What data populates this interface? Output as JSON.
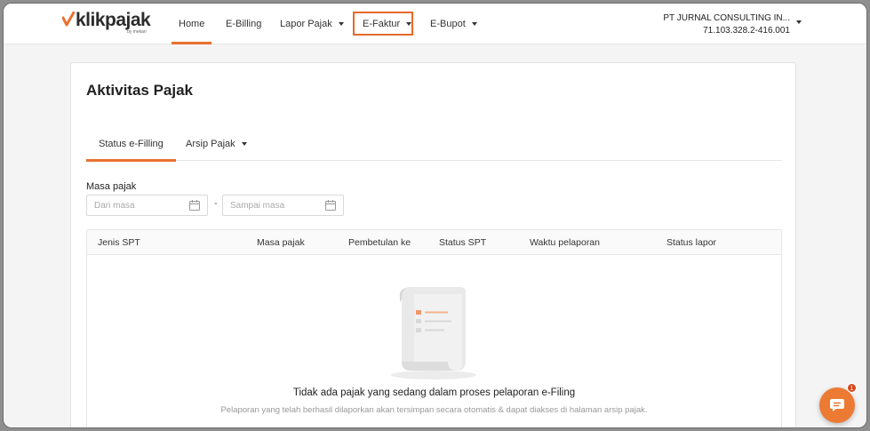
{
  "brand": {
    "name": "klikpajak",
    "sub": "by mekari",
    "accent_color": "#e9702f"
  },
  "nav": {
    "items": [
      {
        "label": "Home",
        "active": true
      },
      {
        "label": "E-Billing"
      },
      {
        "label": "Lapor Pajak",
        "dropdown": true
      },
      {
        "label": "E-Faktur",
        "dropdown": true,
        "highlighted": true
      },
      {
        "label": "E-Bupot",
        "dropdown": true
      }
    ],
    "company": {
      "name": "PT JURNAL CONSULTING IN...",
      "npwp": "71.103.328.2-416.001"
    }
  },
  "page": {
    "title": "Aktivitas Pajak",
    "tabs": [
      {
        "label": "Status e-Filling",
        "active": true
      },
      {
        "label": "Arsip Pajak",
        "dropdown": true
      }
    ],
    "filter": {
      "label": "Masa pajak",
      "from_placeholder": "Dari masa",
      "to_placeholder": "Sampai masa",
      "separator": "-"
    },
    "table": {
      "columns": [
        "Jenis SPT",
        "Masa pajak",
        "Pembetulan ke",
        "Status SPT",
        "Waktu pelaporan",
        "Status lapor"
      ]
    },
    "empty_state": {
      "title": "Tidak ada pajak yang sedang dalam proses pelaporan e-Filing",
      "description": "Pelaporan yang telah berhasil dilaporkan akan tersimpan secara otomatis & dapat diakses di halaman arsip pajak."
    }
  },
  "chat": {
    "badge_count": "1",
    "icon": "chat-icon"
  }
}
